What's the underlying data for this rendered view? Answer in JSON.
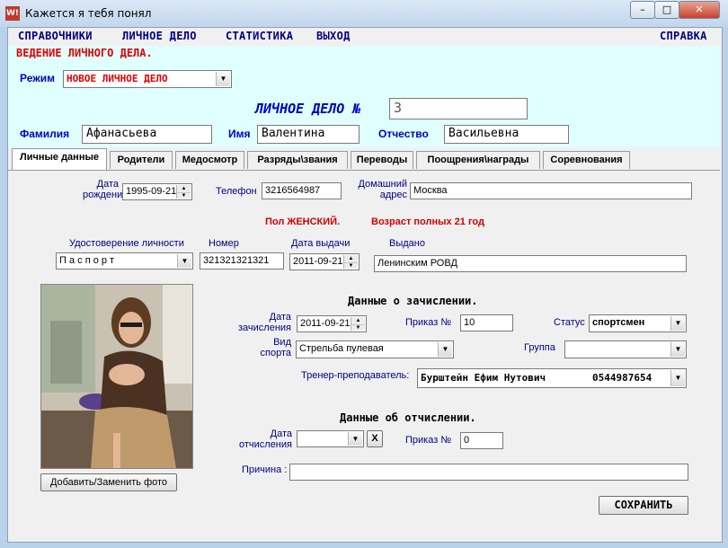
{
  "window": {
    "title": "Кажется я тебя понял",
    "icon_label": "W!"
  },
  "menu": {
    "items": [
      "СПРАВОЧНИКИ",
      "ЛИЧНОЕ ДЕЛО",
      "СТАТИСТИКА",
      "ВЫХОД"
    ],
    "help": "СПРАВКА"
  },
  "section_title": "ВЕДЕНИЕ ЛИЧНОГО ДЕЛА.",
  "mode": {
    "label": "Режим",
    "value": "НОВОЕ ЛИЧНОЕ ДЕЛО"
  },
  "case": {
    "label": "ЛИЧНОЕ ДЕЛО №",
    "number": "3"
  },
  "person": {
    "surname_label": "Фамилия",
    "surname": "Афанасьева",
    "name_label": "Имя",
    "name": "Валентина",
    "patronymic_label": "Отчество",
    "patronymic": "Васильевна"
  },
  "tabs": [
    "Личные данные",
    "Родители",
    "Медосмотр",
    "Разряды\\звания",
    "Переводы",
    "Поощрения\\награды",
    "Соревнования"
  ],
  "personal": {
    "birth_label_1": "Дата",
    "birth_label_2": "рождения",
    "birth_date": "1995-09-21",
    "phone_label": "Телефон",
    "phone": "3216564987",
    "address_label_1": "Домашний",
    "address_label_2": "адрес",
    "address": "Москва",
    "sex_text": "Пол ЖЕНСКИЙ.",
    "age_text": "Возраст полных 21 год",
    "id_doc_label": "Удостоверение личности",
    "id_doc": "П а с п о р т",
    "id_number_label": "Номер",
    "id_number": "321321321321",
    "issue_date_label": "Дата выдачи",
    "issue_date": "2011-09-21",
    "issued_by_label": "Выдано",
    "issued_by": "Ленинским РОВД"
  },
  "photo_button": "Добавить/Заменить фото",
  "enrollment": {
    "heading": "Данные о зачислении.",
    "date_label_1": "Дата",
    "date_label_2": "зачисления",
    "date": "2011-09-21",
    "order_label": "Приказ №",
    "order": "10",
    "status_label": "Статус",
    "status": "спортсмен",
    "sport_label_1": "Вид",
    "sport_label_2": "спорта",
    "sport": "Стрельба пулевая",
    "group_label": "Группа",
    "group": "",
    "coach_label": "Тренер-преподаватель:",
    "coach": "Бурштейн Ефим Нутович",
    "coach_phone": "0544987654"
  },
  "expulsion": {
    "heading": "Данные об отчислении.",
    "date_label_1": "Дата",
    "date_label_2": "отчисления",
    "date": "",
    "clear_label": "X",
    "order_label": "Приказ №",
    "order": "0",
    "reason_label": "Причина :",
    "reason": ""
  },
  "save_button": "СОХРАНИТЬ",
  "colors": {
    "accent_red": "#e00000",
    "label_blue": "#0000c0",
    "header_bg": "#e0ffff"
  }
}
